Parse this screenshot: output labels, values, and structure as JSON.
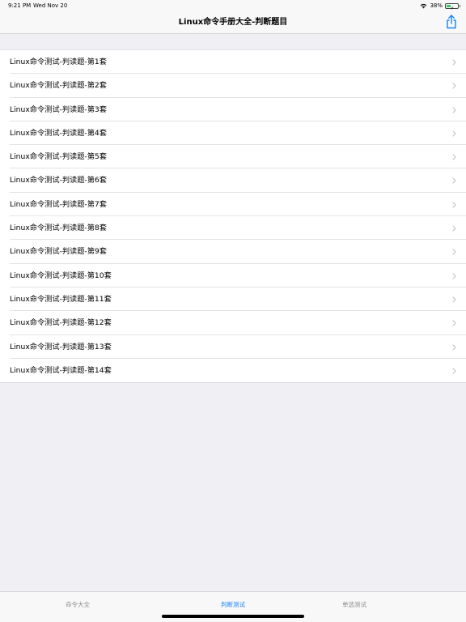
{
  "status": {
    "time": "9:21 PM",
    "date": "Wed Nov 20",
    "battery": "38%",
    "battery_level": 0.38,
    "colors": {
      "battery_fill": "#35c759"
    }
  },
  "nav": {
    "title": "Linux命令手册大全-判断题目",
    "share_icon": "share-icon",
    "accent": "#1a82f7"
  },
  "list": {
    "items": [
      {
        "label": "Linux命令测试-判读题-第1套"
      },
      {
        "label": "Linux命令测试-判读题-第2套"
      },
      {
        "label": "Linux命令测试-判读题-第3套"
      },
      {
        "label": "Linux命令测试-判读题-第4套"
      },
      {
        "label": "Linux命令测试-判读题-第5套"
      },
      {
        "label": "Linux命令测试-判读题-第6套"
      },
      {
        "label": "Linux命令测试-判读题-第7套"
      },
      {
        "label": "Linux命令测试-判读题-第8套"
      },
      {
        "label": "Linux命令测试-判读题-第9套"
      },
      {
        "label": "Linux命令测试-判读题-第10套"
      },
      {
        "label": "Linux命令测试-判读题-第11套"
      },
      {
        "label": "Linux命令测试-判读题-第12套"
      },
      {
        "label": "Linux命令测试-判读题-第13套"
      },
      {
        "label": "Linux命令测试-判读题-第14套"
      }
    ],
    "chevron_icon": "chevron-right-icon"
  },
  "tabs": [
    {
      "label": "命令大全",
      "active": false
    },
    {
      "label": "判断测试",
      "active": true
    },
    {
      "label": "单选测试",
      "active": false
    }
  ]
}
